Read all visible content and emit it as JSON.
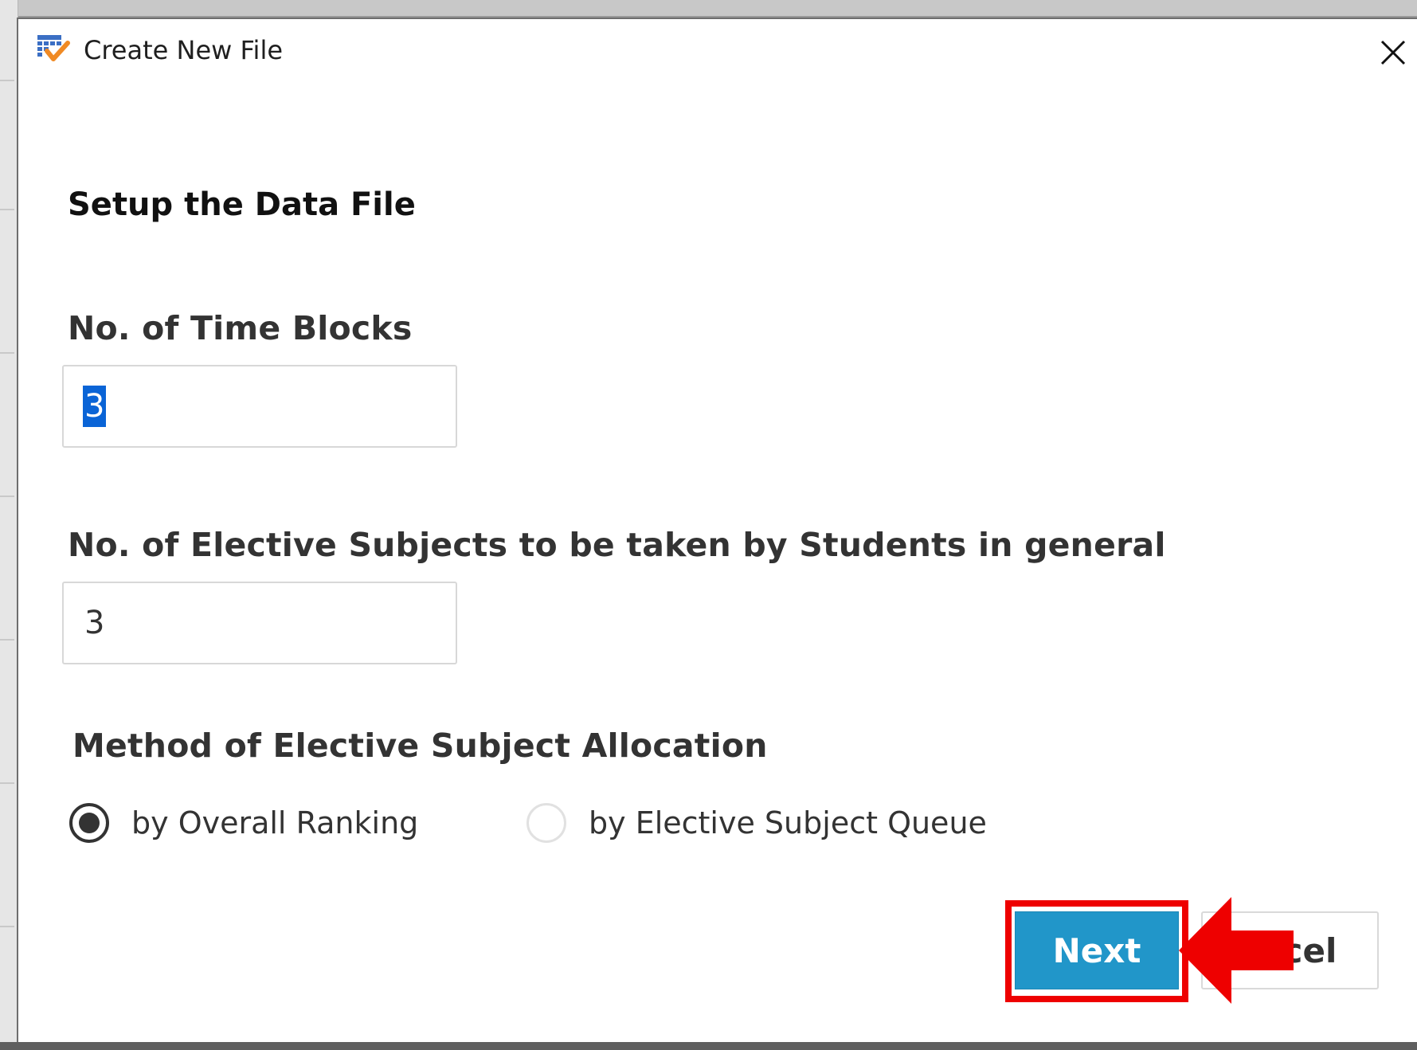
{
  "window": {
    "title": "Create New File"
  },
  "page": {
    "heading": "Setup the Data File"
  },
  "fields": {
    "time_blocks": {
      "label": "No. of Time Blocks",
      "value": "3"
    },
    "elective_subjects": {
      "label": "No. of Elective Subjects to be taken by Students in general",
      "value": "3"
    }
  },
  "allocation": {
    "label": "Method of Elective Subject Allocation",
    "options": [
      {
        "label": "by Overall Ranking",
        "checked": true
      },
      {
        "label": "by Elective Subject Queue",
        "checked": false
      }
    ]
  },
  "buttons": {
    "next_label": "Next",
    "cancel_label": "ncel"
  },
  "icons": {
    "app": "calendar-check-icon",
    "close": "close-icon",
    "annotation": "red-arrow-left-icon"
  },
  "colors": {
    "accent": "#2196c9",
    "highlight": "#ee0000",
    "selection": "#0a64d6"
  }
}
